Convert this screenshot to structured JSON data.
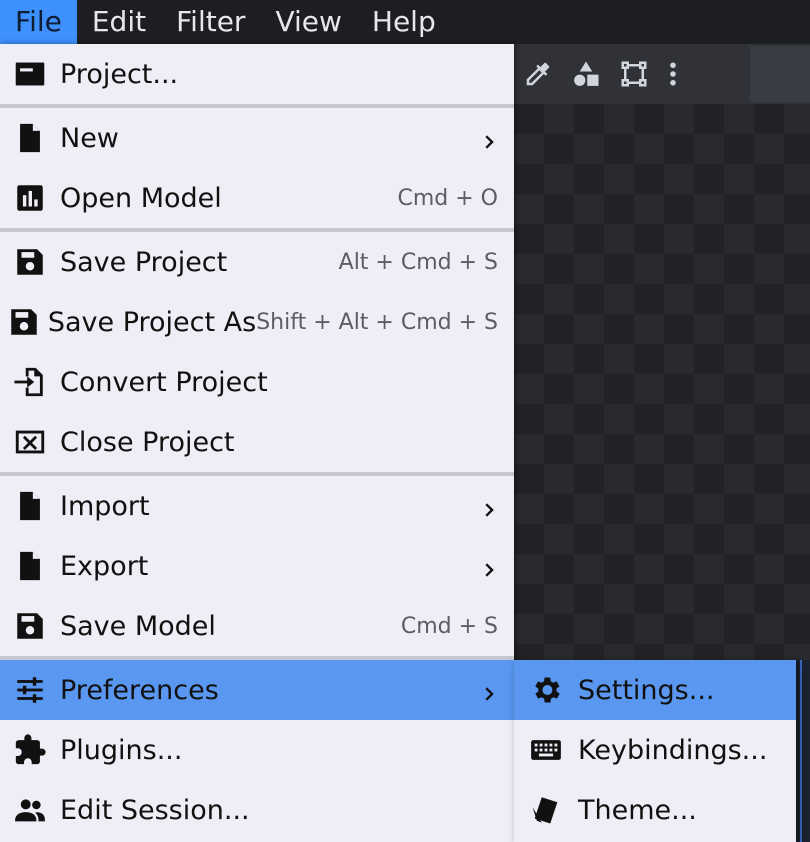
{
  "menubar": {
    "items": [
      {
        "label": "File",
        "active": true
      },
      {
        "label": "Edit",
        "active": false
      },
      {
        "label": "Filter",
        "active": false
      },
      {
        "label": "View",
        "active": false
      },
      {
        "label": "Help",
        "active": false
      }
    ]
  },
  "toolbar": {
    "icons": [
      "eyedropper-icon",
      "shapes-icon",
      "transform-icon",
      "more-vertical-icon"
    ]
  },
  "file_menu": {
    "items": {
      "project": {
        "label": "Project...",
        "icon": "project-icon"
      },
      "new": {
        "label": "New",
        "icon": "file-icon",
        "submenu": true
      },
      "open_model": {
        "label": "Open Model",
        "shortcut": "Cmd + O",
        "icon": "chart-icon"
      },
      "save_project": {
        "label": "Save Project",
        "shortcut": "Alt + Cmd + S",
        "icon": "save-icon"
      },
      "save_project_as": {
        "label": "Save Project As",
        "shortcut": "Shift + Alt + Cmd + S",
        "icon": "save-icon"
      },
      "convert_project": {
        "label": "Convert Project",
        "icon": "convert-icon"
      },
      "close_project": {
        "label": "Close Project",
        "icon": "close-box-icon"
      },
      "import": {
        "label": "Import",
        "icon": "file-icon",
        "submenu": true
      },
      "export": {
        "label": "Export",
        "icon": "file-icon",
        "submenu": true
      },
      "save_model": {
        "label": "Save Model",
        "shortcut": "Cmd + S",
        "icon": "save-icon"
      },
      "preferences": {
        "label": "Preferences",
        "icon": "sliders-icon",
        "submenu": true,
        "highlighted": true
      },
      "plugins": {
        "label": "Plugins...",
        "icon": "puzzle-icon"
      },
      "edit_session": {
        "label": "Edit Session...",
        "icon": "people-icon"
      }
    }
  },
  "preferences_submenu": {
    "items": {
      "settings": {
        "label": "Settings...",
        "icon": "gear-icon",
        "highlighted": true
      },
      "keybindings": {
        "label": "Keybindings...",
        "icon": "keyboard-icon"
      },
      "theme": {
        "label": "Theme...",
        "icon": "theme-cards-icon"
      }
    }
  },
  "colors": {
    "accent": "#3e90ff",
    "highlight": "#5a97f0",
    "menu_bg": "#eeeef6",
    "menubar_bg": "#1d1e22"
  }
}
